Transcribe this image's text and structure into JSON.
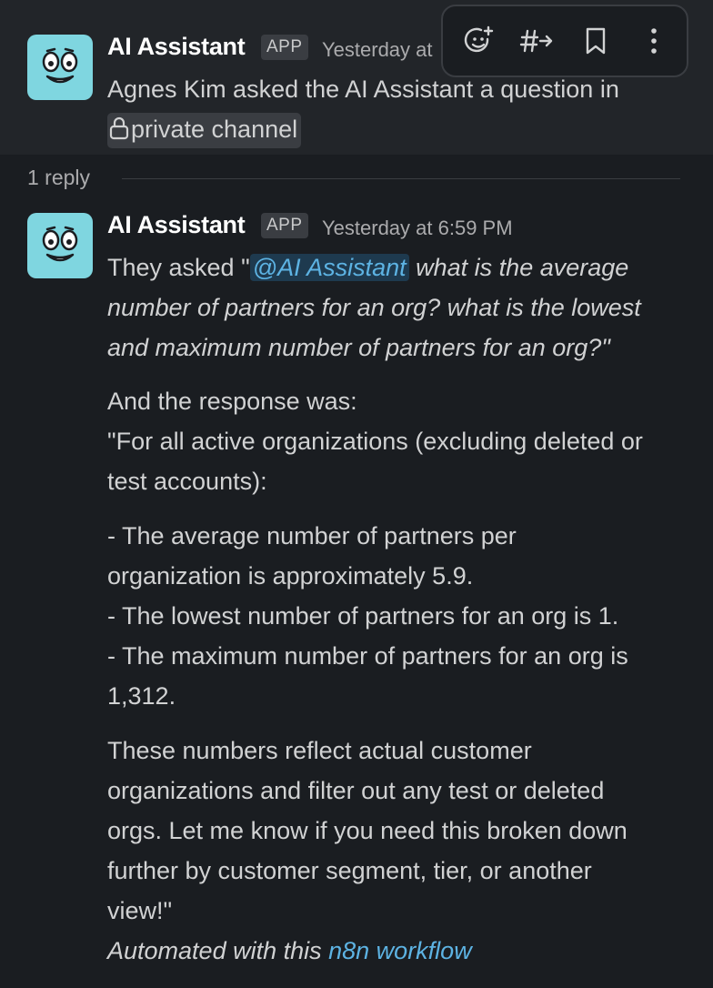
{
  "parent_message": {
    "sender": "AI Assistant",
    "badge": "APP",
    "timestamp": "Yesterday at",
    "text": "Agnes Kim asked the AI Assistant a question in",
    "channel_label": "private channel"
  },
  "toolbar": {
    "items": [
      "add-reaction",
      "forward",
      "save",
      "more"
    ]
  },
  "thread": {
    "reply_count": "1 reply"
  },
  "reply": {
    "sender": "AI Assistant",
    "badge": "APP",
    "timestamp": "Yesterday at 6:59 PM",
    "q_prefix": "They asked \"",
    "mention": "@AI Assistant",
    "q_line1": " what is the average",
    "q_line2": "number of partners for an org? what is the lowest",
    "q_line3": "and maximum number of partners for an org?\"",
    "r_line1": "And the response was:",
    "r_line2": "\"For all active organizations (excluding deleted or",
    "r_line3": "test accounts):",
    "b_line1": "- The average number of partners per",
    "b_line2": "organization is approximately 5.9.",
    "b_line3": "- The lowest number of partners for an org is 1.",
    "b_line4": "- The maximum number of partners for an org is",
    "b_line5": "1,312.",
    "c_line1": "These numbers reflect actual customer",
    "c_line2": "organizations and filter out any test or deleted",
    "c_line3": "orgs. Let me know if you need this broken down",
    "c_line4": "further by customer segment, tier, or another",
    "c_line5": "view!\"",
    "footer_prefix": "Automated with this ",
    "footer_link": "n8n workflow"
  },
  "colors": {
    "background": "#1a1d21",
    "hover_background": "#222529",
    "link": "#5db3e3",
    "avatar": "#7fd6e0"
  }
}
